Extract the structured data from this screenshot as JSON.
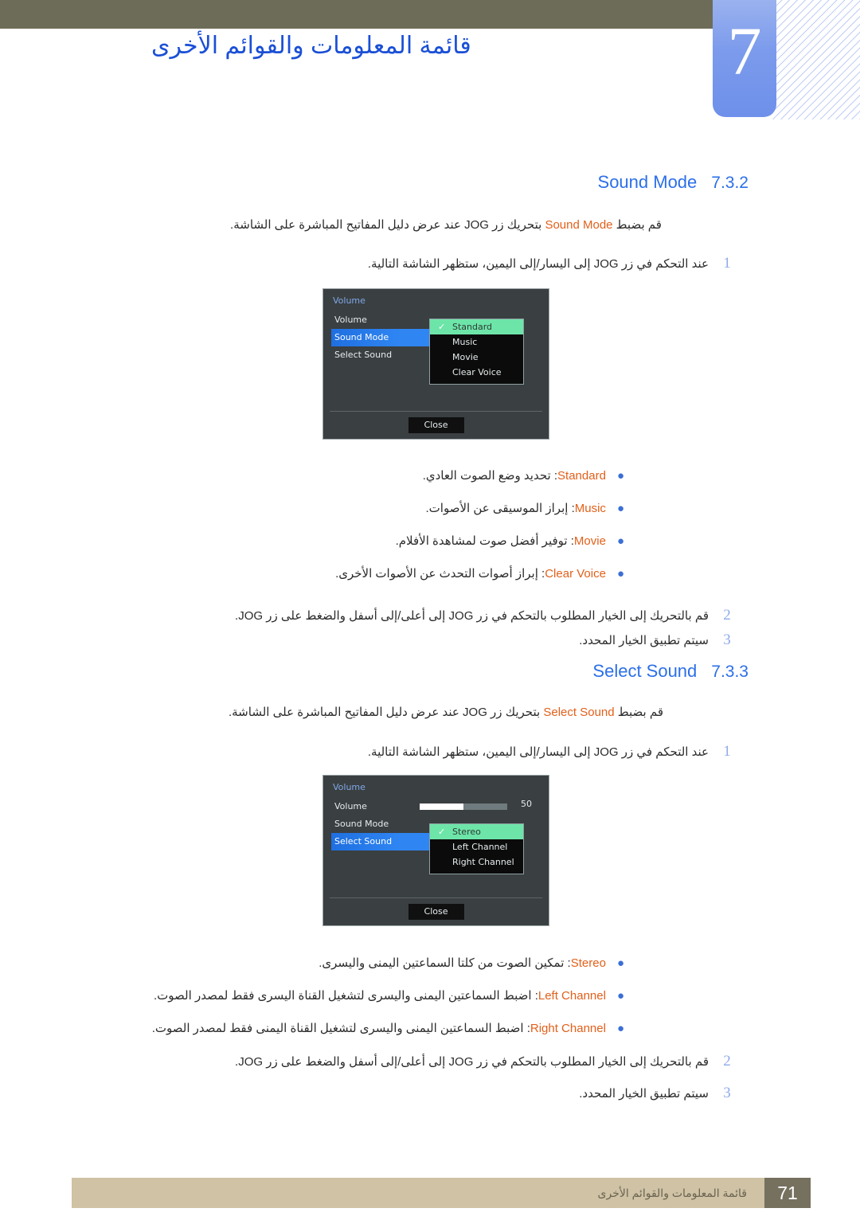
{
  "header": {
    "chapter_number": "7",
    "chapter_title": "قائمة المعلومات والقوائم الأخرى"
  },
  "sections": [
    {
      "number": "7.3.2",
      "label": "Sound Mode",
      "intro_prefix": "قم بضبط ",
      "intro_term": "Sound Mode",
      "intro_suffix": " بتحريك زر JOG عند عرض دليل المفاتيح المباشرة على الشاشة.",
      "step1_num": "1",
      "step1_text": "عند التحكم في زر JOG إلى اليسار/إلى اليمين، ستظهر الشاشة التالية.",
      "osd": {
        "title": "Volume",
        "items": [
          "Volume",
          "Sound Mode",
          "Select Sound"
        ],
        "selected_item": "Sound Mode",
        "submenu": [
          "Standard",
          "Music",
          "Movie",
          "Clear Voice"
        ],
        "submenu_checked": "Standard",
        "close_label": "Close"
      },
      "bullets": [
        {
          "term": "Standard",
          "desc": ": تحديد وضع الصوت العادي."
        },
        {
          "term": "Music",
          "desc": ": إبراز الموسيقى عن الأصوات."
        },
        {
          "term": "Movie",
          "desc": ": توفير أفضل صوت لمشاهدة الأفلام."
        },
        {
          "term": "Clear Voice",
          "desc": ": إبراز أصوات التحدث عن الأصوات الأخرى."
        }
      ],
      "step2_num": "2",
      "step2_text": "قم بالتحريك إلى الخيار المطلوب بالتحكم في زر JOG إلى أعلى/إلى أسفل والضغط على زر JOG.",
      "step3_num": "3",
      "step3_text": "سيتم تطبيق الخيار المحدد."
    },
    {
      "number": "7.3.3",
      "label": "Select Sound",
      "intro_prefix": "قم بضبط ",
      "intro_term": "Select Sound",
      "intro_suffix": " بتحريك زر JOG عند عرض دليل المفاتيح المباشرة على الشاشة.",
      "step1_num": "1",
      "step1_text": "عند التحكم في زر JOG إلى اليسار/إلى اليمين، ستظهر الشاشة التالية.",
      "osd": {
        "title": "Volume",
        "items": [
          "Volume",
          "Sound Mode",
          "Select Sound"
        ],
        "selected_item": "Select Sound",
        "volume_value": "50",
        "submenu": [
          "Stereo",
          "Left Channel",
          "Right Channel"
        ],
        "submenu_checked": "Stereo",
        "close_label": "Close"
      },
      "bullets": [
        {
          "term": "Stereo",
          "desc": ": تمكين الصوت من كلتا السماعتين اليمنى واليسرى."
        },
        {
          "term": "Left Channel",
          "desc": ": اضبط السماعتين اليمنى واليسرى لتشغيل القناة اليسرى فقط لمصدر الصوت."
        },
        {
          "term": "Right Channel",
          "desc": ": اضبط السماعتين اليمنى واليسرى لتشغيل القناة اليمنى فقط لمصدر الصوت."
        }
      ],
      "step2_num": "2",
      "step2_text": "قم بالتحريك إلى الخيار المطلوب بالتحكم في زر JOG إلى أعلى/إلى أسفل والضغط على زر JOG.",
      "step3_num": "3",
      "step3_text": "سيتم تطبيق الخيار المحدد."
    }
  ],
  "footer": {
    "page_number": "71",
    "text": "قائمة المعلومات والقوائم الأخرى"
  },
  "colors": {
    "header_bar": "#6d6c58",
    "chapter_tab": "#7c9bec",
    "heading_blue": "#2b6fe8",
    "term_orange": "#e2601a",
    "footer_bar": "#cfc2a5",
    "footer_page": "#76705f",
    "osd_highlight": "#2f86f3",
    "osd_checked": "#6de5a9"
  }
}
